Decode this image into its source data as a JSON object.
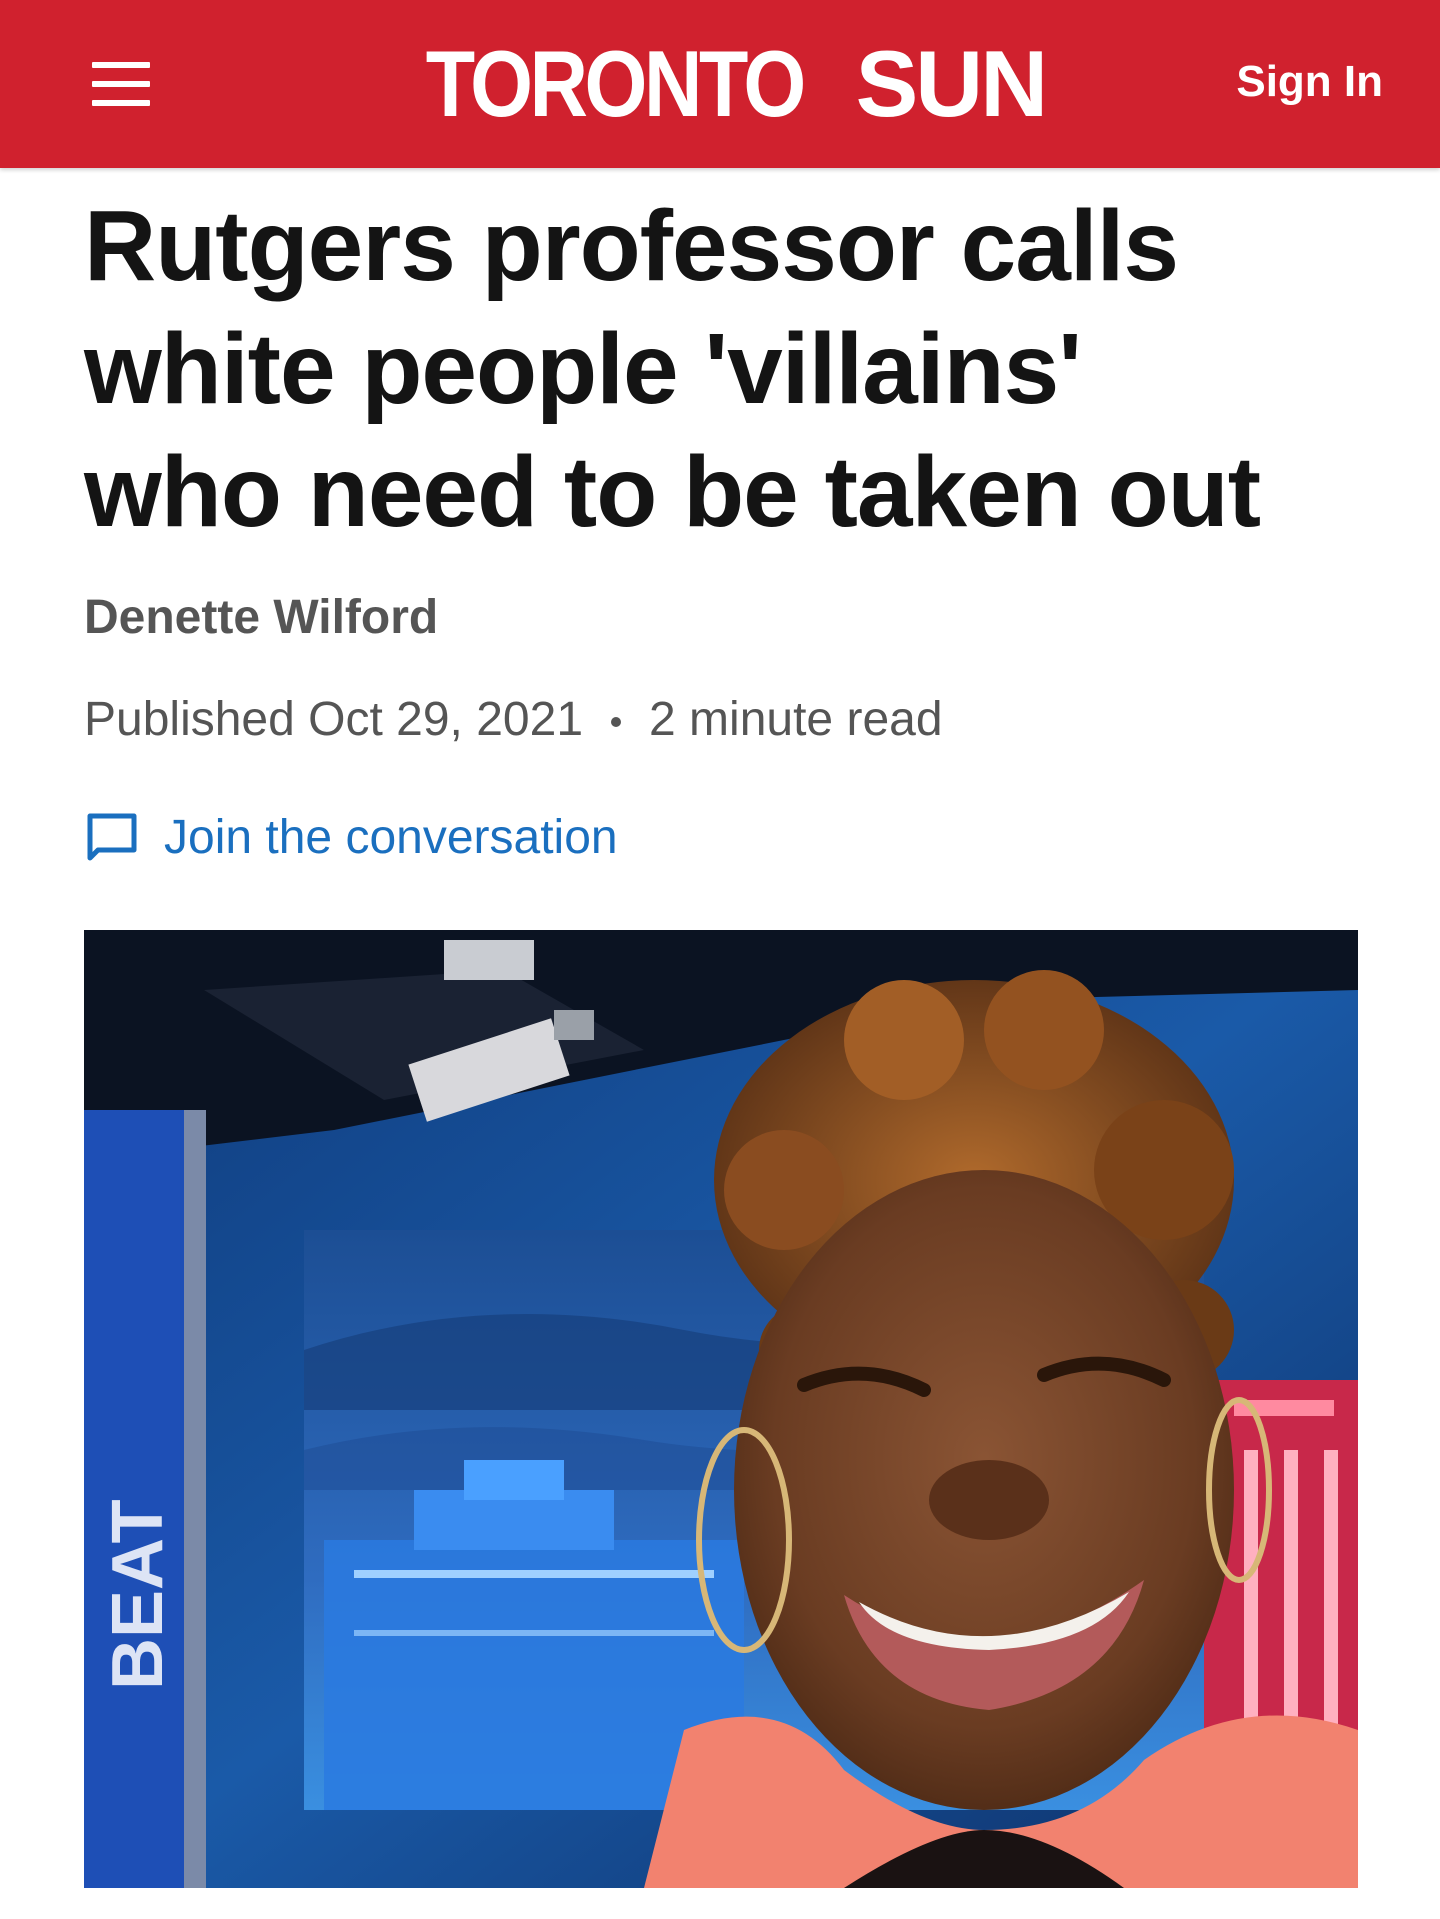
{
  "header": {
    "menu_icon": "hamburger-menu-icon",
    "logo_part1": "TORONTO",
    "logo_part2": "SUN",
    "sign_in_label": "Sign In",
    "brand_color": "#d0212e"
  },
  "article": {
    "headline_line1": "Rutgers professor calls",
    "headline_line2": "white people 'villains'",
    "headline_line3": "who need to be taken out",
    "author": "Denette Wilford",
    "published": "Published Oct 29, 2021",
    "read_time": "2 minute read",
    "conversation_icon": "chat-bubble-icon",
    "conversation_label": "Join the conversation",
    "link_color": "#1a6fbf"
  },
  "hero_image": {
    "studio_wall_text": "BEAT"
  }
}
